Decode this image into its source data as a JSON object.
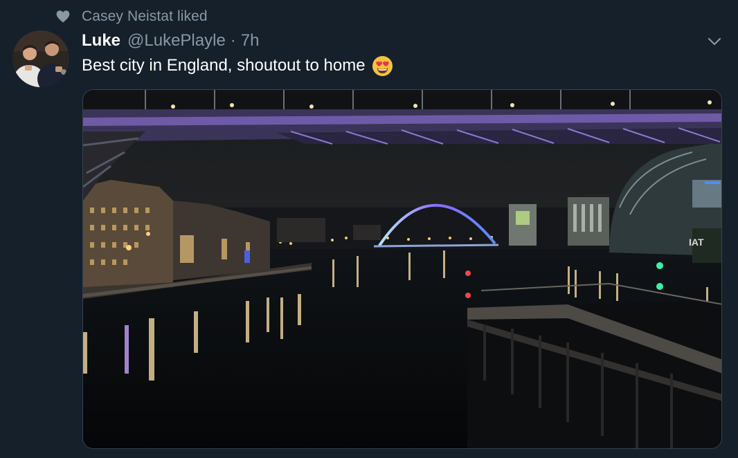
{
  "social_context": {
    "text": "Casey Neistat liked",
    "icon": "heart-icon"
  },
  "tweet": {
    "author_name": "Luke",
    "author_handle": "@LukePlayle",
    "separator": "·",
    "timestamp": "7h",
    "text": "Best city in England, shoutout to home",
    "emoji": "smiling-face-with-heart-eyes",
    "menu_icon": "chevron-down-icon"
  },
  "media": {
    "type": "photo",
    "sign_text": "IAT"
  },
  "colors": {
    "background": "#15202b",
    "primary_text": "#ffffff",
    "secondary_text": "#8899a6",
    "border": "#38444d"
  }
}
